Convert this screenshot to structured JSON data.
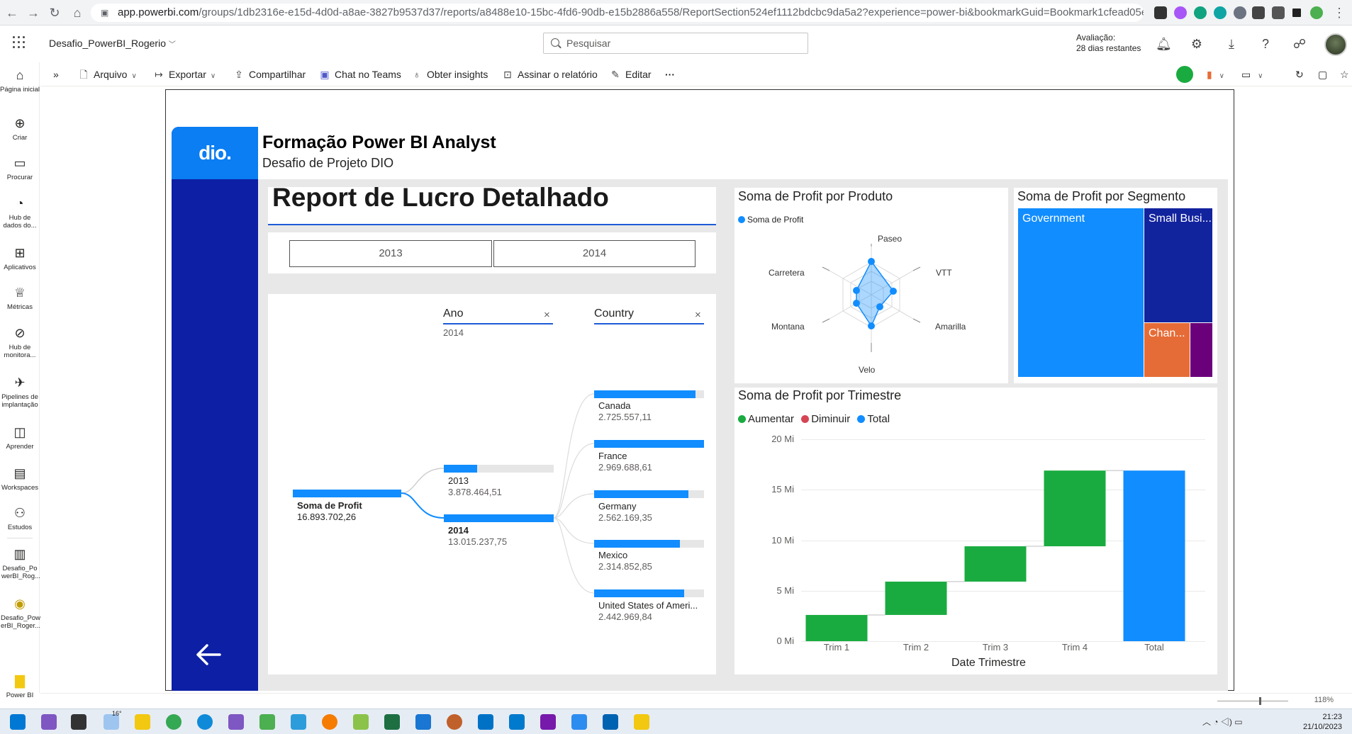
{
  "browser": {
    "url_host": "app.powerbi.com",
    "url_path": "/groups/1db2316e-e15d-4d0d-a8ae-3827b9537d37/reports/a8488e10-15bc-4fd6-90db-e15b2886a558/ReportSection524ef1112bdcbc9da5a2?experience=power-bi&bookmarkGuid=Bookmark1cfead05e..."
  },
  "header": {
    "workspace": "Desafio_PowerBI_Rogerio",
    "search_placeholder": "Pesquisar",
    "trial_line1": "Avaliação:",
    "trial_line2": "28 dias restantes"
  },
  "leftnav": {
    "items": [
      {
        "label": "Página inicial",
        "icon": "home-icon"
      },
      {
        "label": "Criar",
        "icon": "plus-icon"
      },
      {
        "label": "Procurar",
        "icon": "folder-icon"
      },
      {
        "label": "Hub de dados do...",
        "icon": "data-hub-icon"
      },
      {
        "label": "Aplicativos",
        "icon": "apps-icon"
      },
      {
        "label": "Métricas",
        "icon": "trophy-icon"
      },
      {
        "label": "Hub de monitora...",
        "icon": "monitor-icon"
      },
      {
        "label": "Pipelines de implantação",
        "icon": "rocket-icon"
      },
      {
        "label": "Aprender",
        "icon": "book-icon"
      },
      {
        "label": "Workspaces",
        "icon": "workspaces-icon"
      },
      {
        "label": "Estudos",
        "icon": "people-icon"
      },
      {
        "label": "Desafio_Po werBI_Rog...",
        "icon": "report-icon"
      },
      {
        "label": "Desafio_Pow erBI_Roger...",
        "icon": "dataset-icon"
      },
      {
        "label": "Power BI",
        "icon": "powerbi-logo-icon"
      }
    ]
  },
  "commandbar": {
    "file": "Arquivo",
    "export": "Exportar",
    "share": "Compartilhar",
    "teams": "Chat no Teams",
    "insights": "Obter insights",
    "subscribe": "Assinar o relatório",
    "edit": "Editar",
    "more": "···"
  },
  "report": {
    "logo_text": "dio.",
    "title": "Formação Power BI Analyst",
    "subtitle": "Desafio de Projeto DIO",
    "page_heading": "Report de Lucro Detalhado",
    "year_slicer": [
      "2013",
      "2014"
    ]
  },
  "decomp_tree": {
    "col1_header": "Ano",
    "col1_filter": "2014",
    "col2_header": "Country",
    "root": {
      "label": "Soma de Profit",
      "value": "16.893.702,26"
    },
    "years": [
      {
        "label": "2013",
        "value": "3.878.464,51",
        "fraction": 0.3
      },
      {
        "label": "2014",
        "value": "13.015.237,75",
        "fraction": 1.0
      }
    ],
    "countries": [
      {
        "label": "Canada",
        "value": "2.725.557,11",
        "fraction": 0.92
      },
      {
        "label": "France",
        "value": "2.969.688,61",
        "fraction": 1.0
      },
      {
        "label": "Germany",
        "value": "2.562.169,35",
        "fraction": 0.86
      },
      {
        "label": "Mexico",
        "value": "2.314.852,85",
        "fraction": 0.78
      },
      {
        "label": "United States of Ameri...",
        "value": "2.442.969,84",
        "fraction": 0.82
      }
    ]
  },
  "radar": {
    "title": "Soma de Profit por Produto",
    "legend": "Soma de Profit",
    "color": "#118dff",
    "axes": [
      "Paseo",
      "VTT",
      "Amarilla",
      "Velo",
      "Montana",
      "Carretera"
    ]
  },
  "treemap": {
    "title": "Soma de Profit por Segmento",
    "segments": [
      {
        "label": "Government",
        "color": "#118dff"
      },
      {
        "label": "Small Busi...",
        "color": "#12239e"
      },
      {
        "label": "Chan...",
        "color": "#e66c37"
      },
      {
        "label": "",
        "color": "#6b007b"
      }
    ]
  },
  "waterfall_legend": {
    "increase": "Aumentar",
    "decrease": "Diminuir",
    "total": "Total",
    "increase_color": "#1aab40",
    "decrease_color": "#d64554",
    "total_color": "#118dff"
  },
  "chart_data": {
    "type": "bar",
    "subtype": "waterfall",
    "title": "Soma de Profit por Trimestre",
    "xlabel": "Date Trimestre",
    "ylabel": "",
    "categories": [
      "Trim 1",
      "Trim 2",
      "Trim 3",
      "Trim 4",
      "Total"
    ],
    "series": [
      {
        "name": "Aumentar",
        "values": [
          2.6,
          3.3,
          3.5,
          7.5,
          null
        ]
      },
      {
        "name": "Total",
        "values": [
          null,
          null,
          null,
          null,
          16.9
        ]
      }
    ],
    "running_start": [
      0,
      2.6,
      5.9,
      9.4,
      0
    ],
    "yticks": [
      "0 Mi",
      "5 Mi",
      "10 Mi",
      "15 Mi",
      "20 Mi"
    ],
    "ylim": [
      0,
      20
    ],
    "grid": true,
    "legend_position": "top-left"
  },
  "statusbar": {
    "zoom": "118%"
  },
  "taskbar": {
    "weather": "16°",
    "time": "21:23",
    "date": "21/10/2023"
  }
}
